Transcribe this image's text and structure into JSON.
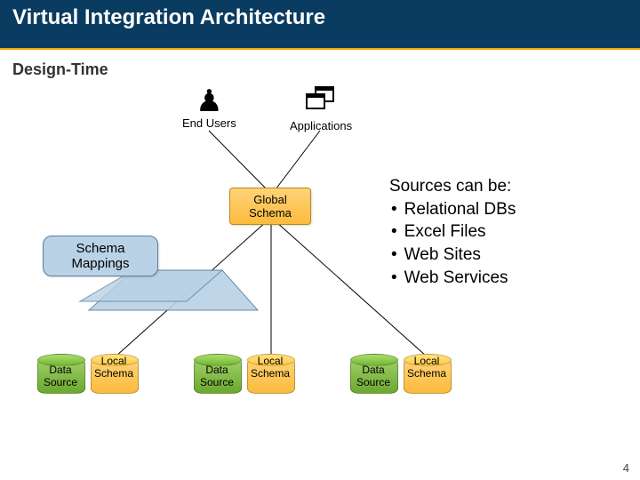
{
  "title": "Virtual Integration Architecture",
  "subtitle": "Design-Time",
  "top": {
    "end_users": "End Users",
    "applications": "Applications"
  },
  "global_schema": "Global\nSchema",
  "schema_mappings": "Schema\nMappings",
  "triples": [
    {
      "data_source": "Data\nSource",
      "local_schema": "Local\nSchema"
    },
    {
      "data_source": "Data\nSource",
      "local_schema": "Local\nSchema"
    },
    {
      "data_source": "Data\nSource",
      "local_schema": "Local\nSchema"
    }
  ],
  "sources": {
    "heading": "Sources can be:",
    "items": [
      "Relational DBs",
      "Excel Files",
      "Web Sites",
      "Web Services"
    ]
  },
  "slide_number": "4",
  "colors": {
    "title_bg": "#0a3b60",
    "accent": "#f2a900",
    "callout_bg": "#b9d2e6",
    "schema_bg": "#fbbb3c",
    "source_green": "#6aa92f"
  }
}
